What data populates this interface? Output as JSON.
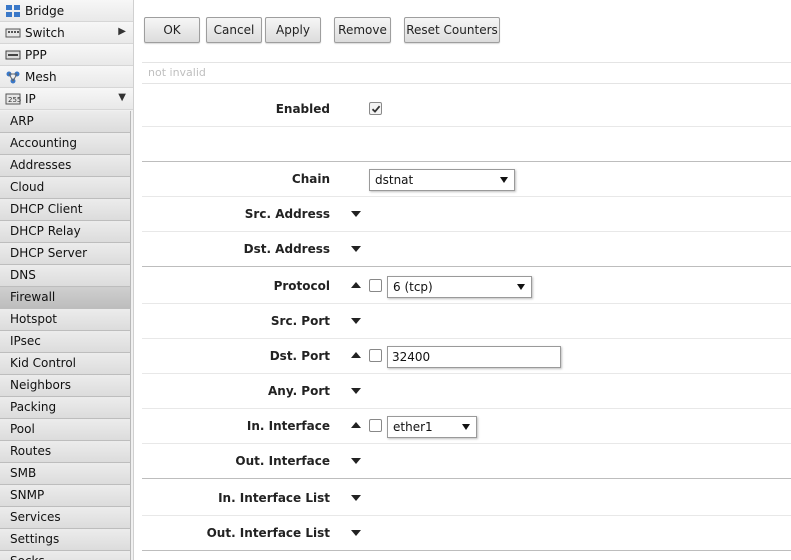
{
  "sidebar": {
    "top_items": [
      {
        "label": "Bridge",
        "icon": "bridge-icon",
        "has_arrow": false
      },
      {
        "label": "Switch",
        "icon": "switch-icon",
        "has_arrow": true,
        "arrow": "▶"
      },
      {
        "label": "PPP",
        "icon": "ppp-icon",
        "has_arrow": false
      },
      {
        "label": "Mesh",
        "icon": "mesh-icon",
        "has_arrow": false
      },
      {
        "label": "IP",
        "icon": "ip-icon",
        "has_arrow": true,
        "arrow": "▼"
      }
    ],
    "sub_items": [
      "ARP",
      "Accounting",
      "Addresses",
      "Cloud",
      "DHCP Client",
      "DHCP Relay",
      "DHCP Server",
      "DNS",
      "Firewall",
      "Hotspot",
      "IPsec",
      "Kid Control",
      "Neighbors",
      "Packing",
      "Pool",
      "Routes",
      "SMB",
      "SNMP",
      "Services",
      "Settings",
      "Socks"
    ],
    "active_sub_item": "Firewall"
  },
  "toolbar": {
    "ok": "OK",
    "cancel": "Cancel",
    "apply": "Apply",
    "remove": "Remove",
    "reset_counters": "Reset Counters"
  },
  "status": "not invalid",
  "form": {
    "enabled": {
      "label": "Enabled",
      "checked": true
    },
    "chain": {
      "label": "Chain",
      "value": "dstnat"
    },
    "src_address": {
      "label": "Src. Address"
    },
    "dst_address": {
      "label": "Dst. Address"
    },
    "protocol": {
      "label": "Protocol",
      "value": "6 (tcp)"
    },
    "src_port": {
      "label": "Src. Port"
    },
    "dst_port": {
      "label": "Dst. Port",
      "value": "32400"
    },
    "any_port": {
      "label": "Any. Port"
    },
    "in_interface": {
      "label": "In. Interface",
      "value": "ether1"
    },
    "out_interface": {
      "label": "Out. Interface"
    },
    "in_interface_list": {
      "label": "In. Interface List"
    },
    "out_interface_list": {
      "label": "Out. Interface List"
    }
  },
  "colors": {
    "sidebar_bg": "#f0f0f0",
    "active_item": "#c4c4c4",
    "button_border": "#9e9e9e"
  }
}
